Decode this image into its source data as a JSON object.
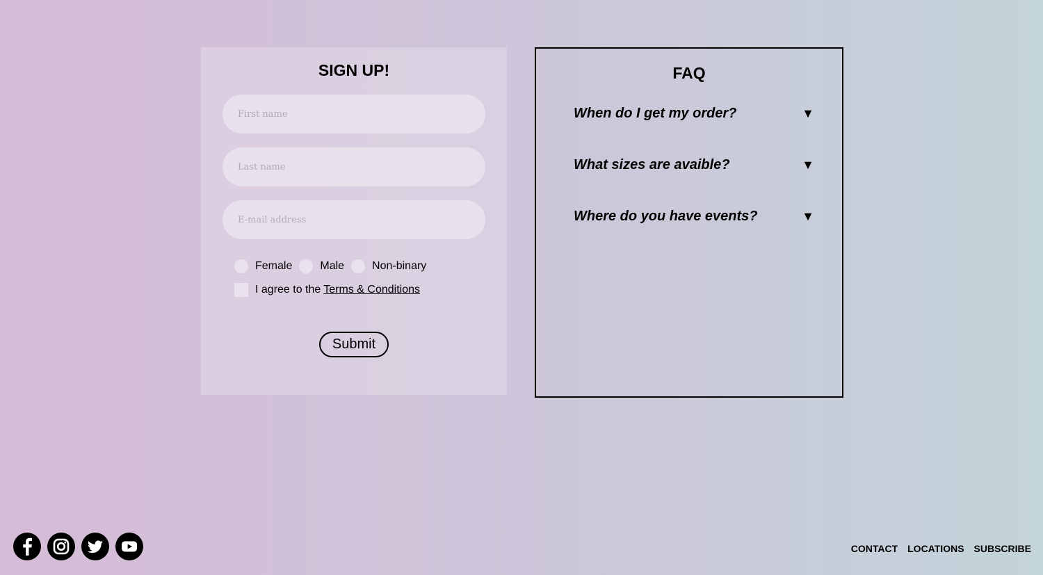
{
  "signup": {
    "title": "SIGN UP!",
    "first_name_placeholder": "First name",
    "last_name_placeholder": "Last name",
    "email_placeholder": "E-mail address",
    "gender_options": [
      "Female",
      "Male",
      "Non-binary"
    ],
    "terms_prefix": "I agree to the",
    "terms_link": "Terms & Conditions",
    "submit_label": "Submit"
  },
  "faq": {
    "title": "FAQ",
    "items": [
      {
        "question": "When do I get my order?",
        "arrow": "▼"
      },
      {
        "question": "What sizes are avaible?",
        "arrow": "▼"
      },
      {
        "question": "Where do you have events?",
        "arrow": "▼"
      }
    ]
  },
  "social_icons": [
    "facebook-icon",
    "instagram-icon",
    "twitter-icon",
    "youtube-icon"
  ],
  "footer_nav": [
    "CONTACT",
    "LOCATIONS",
    "SUBSCRIBE"
  ],
  "colors": {
    "gradient_left": "#d6bcd7",
    "gradient_right": "#c3d4da",
    "text": "#000000"
  }
}
